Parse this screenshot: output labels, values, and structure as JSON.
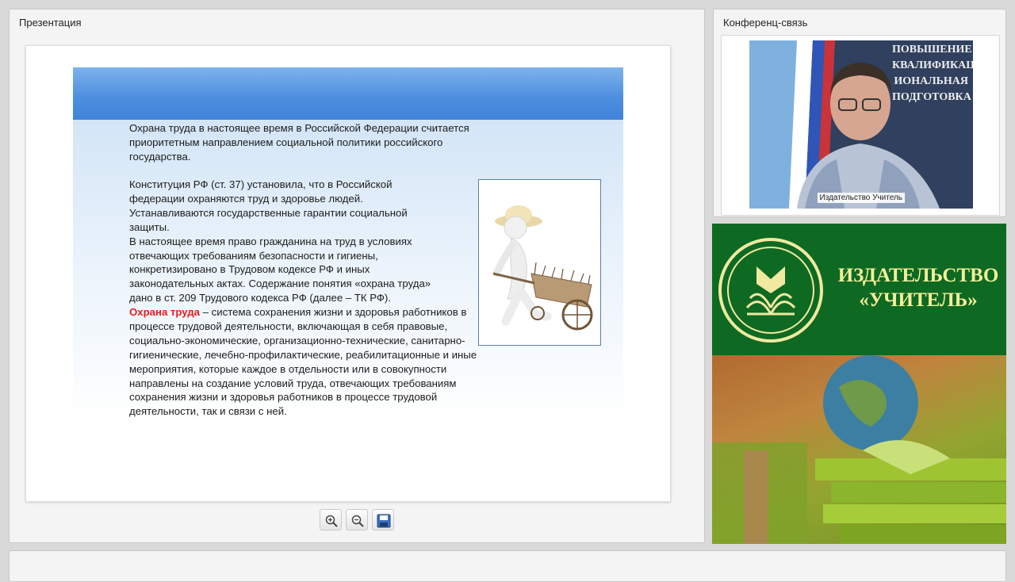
{
  "presentation_panel": {
    "title": "Презентация",
    "slide": {
      "paragraph_1": "Охрана труда в настоящее время в Российской Федерации считается приоритетным направлением социальной политики российского государства.",
      "paragraph_2_lines": [
        "Конституция РФ (ст. 37) установила, что в Российской",
        "федерации охраняются труд и здоровье людей.",
        "Устанавливаются государственные гарантии социальной",
        "защиты.",
        "В настоящее время право гражданина на труд в условиях",
        "отвечающих требованиям безопасности и гигиены,",
        "конкретизировано в Трудовом кодексе РФ и иных",
        "законодательных актах. Содержание понятия «охрана труда»",
        "дано в ст. 209 Трудового кодекса РФ (далее – ТК РФ)."
      ],
      "definition_term": "Охрана труда",
      "definition_text": " – система сохранения жизни и здоровья работников в процессе трудовой деятельности, включающая в себя правовые, социально-экономические, организационно-технические, санитарно-гигиенические, лечебно-профилактические, реабилитационные и иные мероприятия, которые каждое в отдельности или в совокупности направлены на создание условий труда, отвечающих требованиям сохранения жизни и здоровья работников в процессе трудовой деятельности, так и связи с ней."
    },
    "toolbar": {
      "zoom_in_icon": "zoom-in-icon",
      "zoom_out_icon": "zoom-out-icon",
      "save_icon": "floppy-disk-icon"
    }
  },
  "conference_panel": {
    "title": "Конференц-связь",
    "speaker_name": "Издательство Учитель",
    "backdrop_lines": [
      "ПОВЫШЕНИЕ",
      "КВАЛИФИКАЦИИ",
      "ИОНАЛЬНАЯ",
      "ПОДГОТОВКА"
    ]
  },
  "publisher_banner": {
    "name_line_1": "ИЗДАТЕЛЬСТВО",
    "name_line_2": "«УЧИТЕЛЬ»"
  },
  "colors": {
    "banner_green": "#0e6a22",
    "banner_text": "#f5ef9a",
    "slide_header_blue": "#4f8fe0",
    "definition_red": "#e02020"
  }
}
